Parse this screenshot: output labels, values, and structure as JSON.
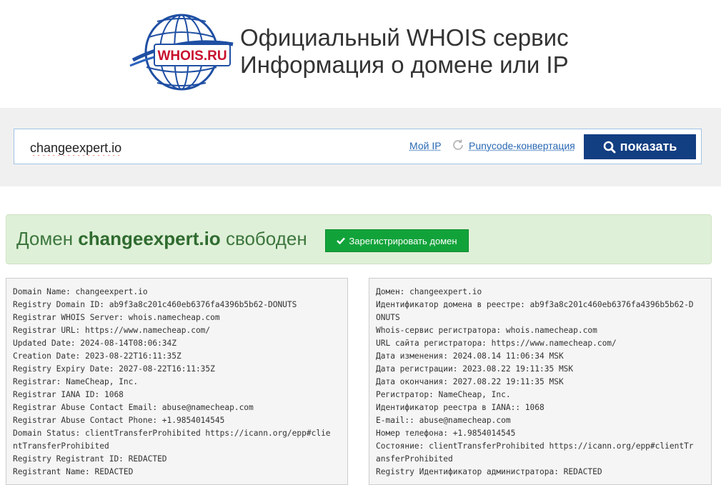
{
  "logo": {
    "text": "WHOIS.RU"
  },
  "header": {
    "title_line1": "Официальный WHOIS сервис",
    "title_line2": "Информация о домене или IP"
  },
  "search": {
    "value": "changeexpert.io",
    "my_ip_label": "Мой IP",
    "punycode_label": "Punycode-конвертация",
    "show_label": "показать"
  },
  "status": {
    "prefix": "Домен",
    "domain": "changeexpert.io",
    "suffix": "свободен",
    "register_label": "Зарегистрировать домен"
  },
  "whois_en": [
    "Domain Name: changeexpert.io",
    "Registry Domain ID: ab9f3a8c201c460eb6376fa4396b5b62-DONUTS",
    "Registrar WHOIS Server: whois.namecheap.com",
    "Registrar URL: https://www.namecheap.com/",
    "Updated Date: 2024-08-14T08:06:34Z",
    "Creation Date: 2023-08-22T16:11:35Z",
    "Registry Expiry Date: 2027-08-22T16:11:35Z",
    "Registrar: NameCheap, Inc.",
    "Registrar IANA ID: 1068",
    "Registrar Abuse Contact Email: abuse@namecheap.com",
    "Registrar Abuse Contact Phone: +1.9854014545",
    "Domain Status: clientTransferProhibited https://icann.org/epp#clie",
    "ntTransferProhibited",
    "Registry Registrant ID: REDACTED",
    "Registrant Name: REDACTED"
  ],
  "whois_ru": [
    "Домен: changeexpert.io",
    "Идентификатор домена в реестре: ab9f3a8c201c460eb6376fa4396b5b62-D",
    "ONUTS",
    "Whois-сервис регистратора: whois.namecheap.com",
    "URL сайта регистратора: https://www.namecheap.com/",
    "Дата изменения: 2024.08.14 11:06:34 MSK",
    "Дата регистрации: 2023.08.22 19:11:35 MSK",
    "Дата окончания: 2027.08.22 19:11:35 MSK",
    "Регистратор: NameCheap, Inc.",
    "Идентификатор реестра в IANA:: 1068",
    "E-mail:: abuse@namecheap.com",
    "Номер телефона: +1.9854014545",
    "Состояние: clientTransferProhibited https://icann.org/epp#clientTr",
    "ansferProhibited",
    "Registry Идентификатор администратора: REDACTED"
  ]
}
